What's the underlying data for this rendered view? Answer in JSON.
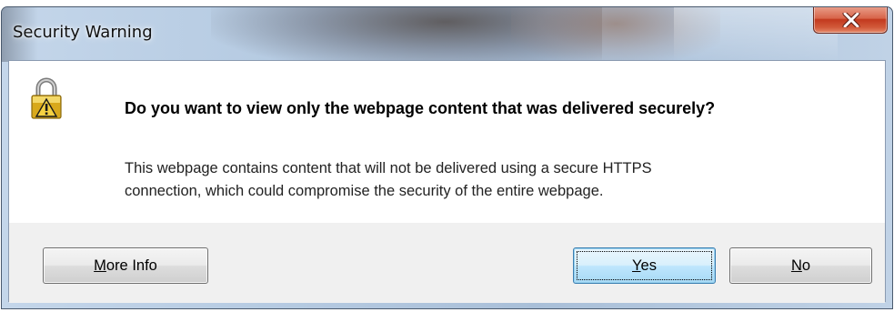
{
  "window": {
    "title": "Security Warning",
    "close_icon": "close-x-icon"
  },
  "message": {
    "icon": "padlock-icon",
    "heading": "Do you want to view only the webpage content that was delivered securely?",
    "body_line1": "This webpage contains content that will not be delivered using a secure HTTPS",
    "body_line2": "connection, which could compromise the security of the entire webpage."
  },
  "buttons": {
    "more_info": {
      "accel": "M",
      "rest": "ore Info"
    },
    "yes": {
      "accel": "Y",
      "rest": "es"
    },
    "no": {
      "accel": "N",
      "rest": "o"
    }
  },
  "colors": {
    "close_button": "#c2391e",
    "default_button_border": "#3c7fb1",
    "client_background": "#f0f0f0",
    "lock_gold": "#d8a91c"
  }
}
